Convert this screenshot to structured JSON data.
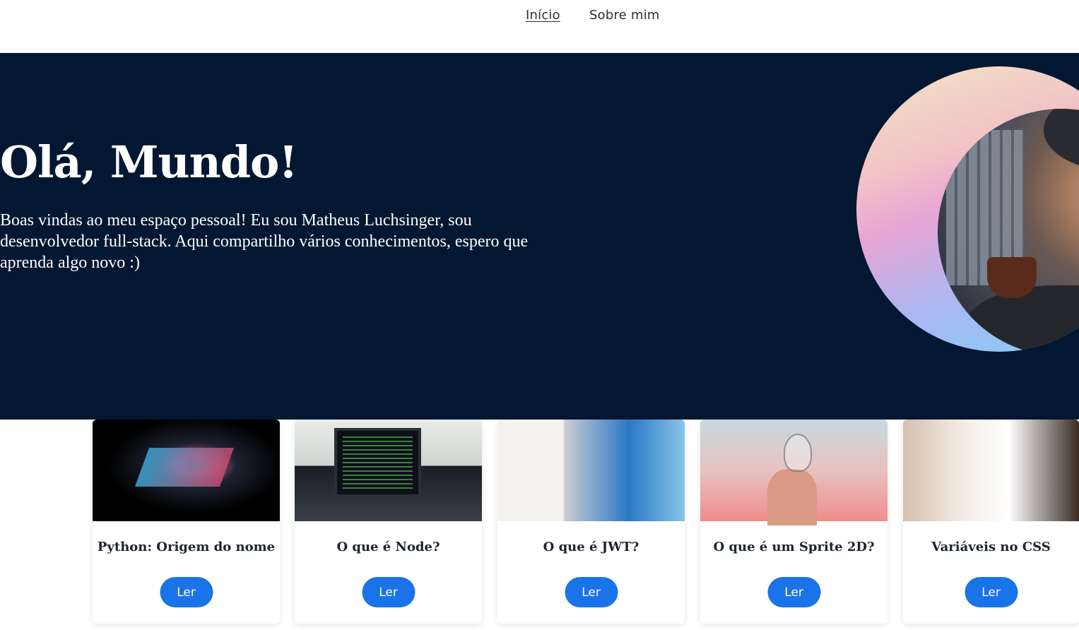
{
  "nav": {
    "items": [
      {
        "label": "Início",
        "active": true
      },
      {
        "label": "Sobre mim",
        "active": false
      }
    ]
  },
  "hero": {
    "title": "Olá, Mundo!",
    "text": "Boas vindas ao meu espaço pessoal! Eu sou Matheus Luchsinger, sou desenvolvedor full-stack. Aqui compartilho vários conhecimentos, espero que aprenda algo novo :)",
    "background": "#021732"
  },
  "cards": [
    {
      "title": "Python: Origem do nome",
      "button": "Ler"
    },
    {
      "title": "O que é Node?",
      "button": "Ler"
    },
    {
      "title": "O que é JWT?",
      "button": "Ler"
    },
    {
      "title": "O que é um Sprite 2D?",
      "button": "Ler"
    },
    {
      "title": "Variáveis no CSS",
      "button": "Ler"
    }
  ],
  "colors": {
    "accent": "#1a73e8",
    "hero_bg": "#021732",
    "text_dark": "#1d2430"
  }
}
